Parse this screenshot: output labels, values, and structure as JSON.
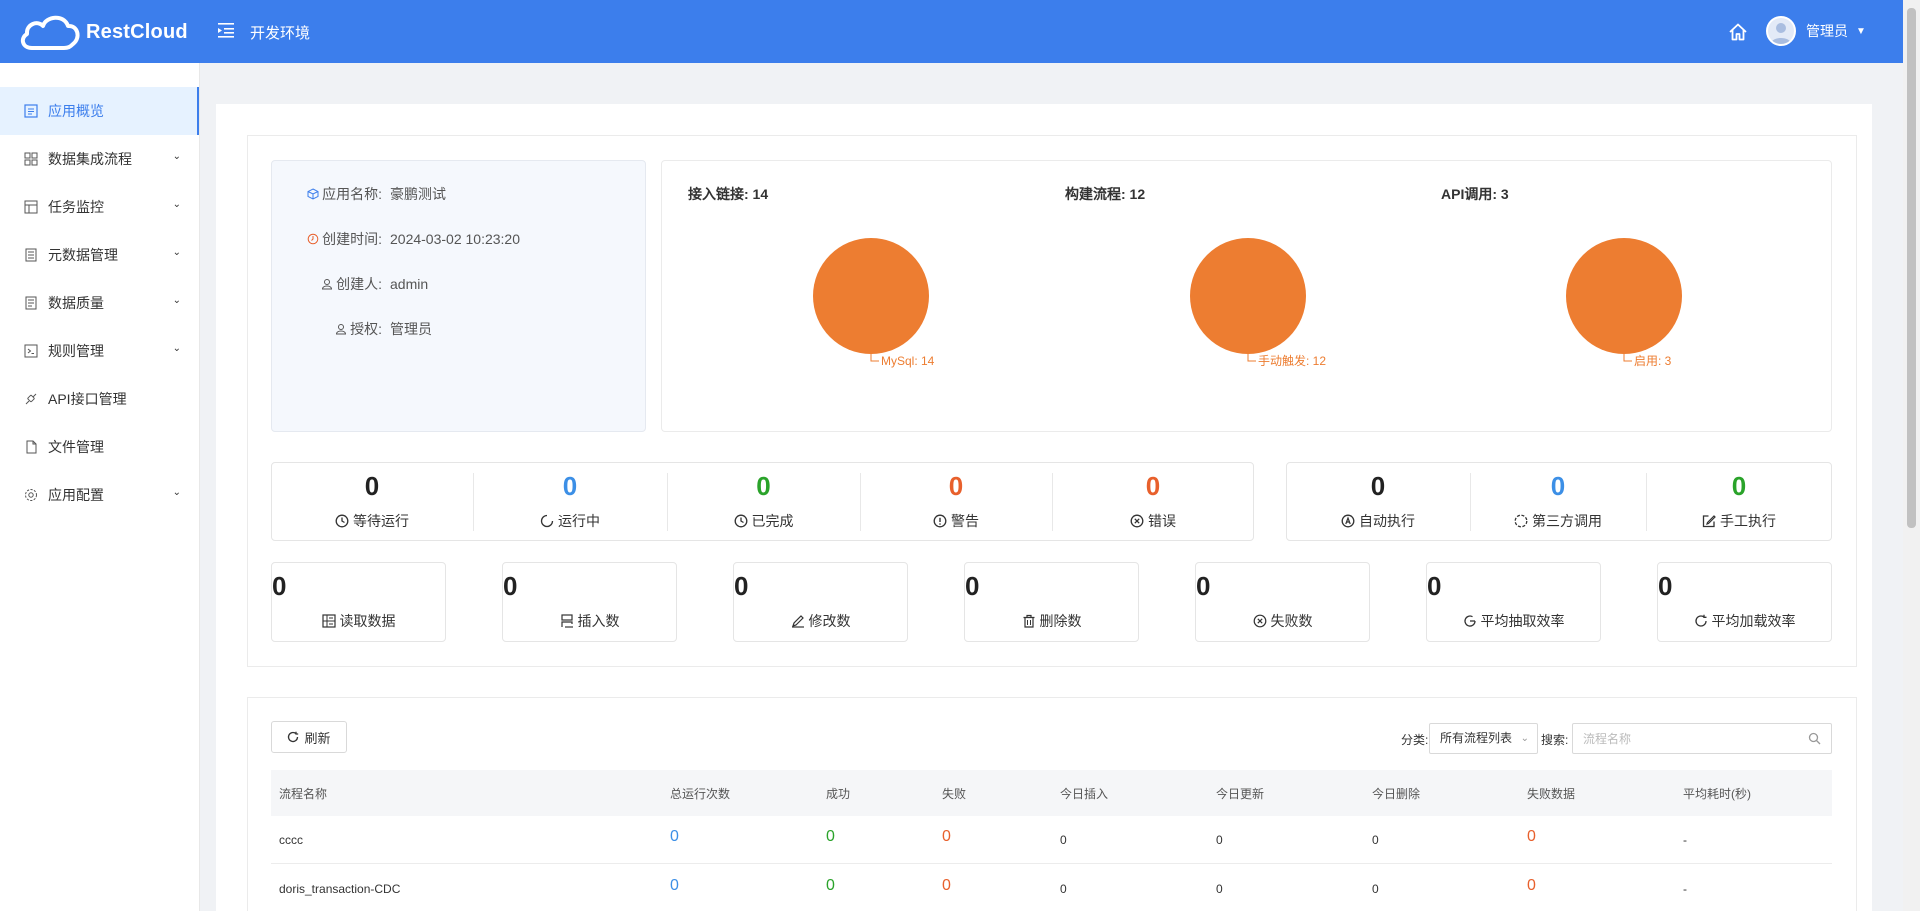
{
  "header": {
    "logo_text": "RestCloud",
    "env_label": "开发环境",
    "user_name": "管理员"
  },
  "sidebar": {
    "items": [
      {
        "label": "应用概览",
        "icon": "overview-icon",
        "active": true,
        "expandable": false
      },
      {
        "label": "数据集成流程",
        "icon": "grid-icon",
        "expandable": true
      },
      {
        "label": "任务监控",
        "icon": "monitor-icon",
        "expandable": true
      },
      {
        "label": "元数据管理",
        "icon": "metadata-icon",
        "expandable": true
      },
      {
        "label": "数据质量",
        "icon": "quality-icon",
        "expandable": true
      },
      {
        "label": "规则管理",
        "icon": "rule-icon",
        "expandable": true
      },
      {
        "label": "API接口管理",
        "icon": "api-icon",
        "expandable": false
      },
      {
        "label": "文件管理",
        "icon": "file-icon",
        "expandable": false
      },
      {
        "label": "应用配置",
        "icon": "settings-icon",
        "expandable": true
      }
    ]
  },
  "app_info": {
    "name_label": "应用名称:",
    "name_value": "豪鹏测试",
    "created_label": "创建时间:",
    "created_value": "2024-03-02 10:23:20",
    "creator_label": "创建人:",
    "creator_value": "admin",
    "auth_label": "授权:",
    "auth_value": "管理员"
  },
  "pies": [
    {
      "title": "接入链接: 14",
      "slice_label": "MySql: 14",
      "slices": [
        {
          "name": "MySql",
          "value": 14
        }
      ]
    },
    {
      "title": "构建流程: 12",
      "slice_label": "手动触发: 12",
      "slices": [
        {
          "name": "手动触发",
          "value": 12
        }
      ]
    },
    {
      "title": "API调用: 3",
      "slice_label": "启用: 3",
      "slices": [
        {
          "name": "启用",
          "value": 3
        }
      ]
    }
  ],
  "status_stats": [
    {
      "value": "0",
      "label": "等待运行",
      "color": "#222222",
      "icon": "clock-icon"
    },
    {
      "value": "0",
      "label": "运行中",
      "color": "#3c8fe6",
      "icon": "loading-icon"
    },
    {
      "value": "0",
      "label": "已完成",
      "color": "#2aa32a",
      "icon": "clock-check-icon"
    },
    {
      "value": "0",
      "label": "警告",
      "color": "#e8602c",
      "icon": "warning-icon"
    },
    {
      "value": "0",
      "label": "错误",
      "color": "#e8602c",
      "icon": "error-icon"
    }
  ],
  "exec_stats": [
    {
      "value": "0",
      "label": "自动执行",
      "color": "#222222",
      "icon": "auto-icon"
    },
    {
      "value": "0",
      "label": "第三方调用",
      "color": "#3c8fe6",
      "icon": "third-party-icon"
    },
    {
      "value": "0",
      "label": "手工执行",
      "color": "#2aa32a",
      "icon": "edit-icon"
    }
  ],
  "data_stats": [
    {
      "value": "0",
      "label": "读取数据",
      "icon": "read-icon"
    },
    {
      "value": "0",
      "label": "插入数",
      "icon": "insert-icon"
    },
    {
      "value": "0",
      "label": "修改数",
      "icon": "modify-icon"
    },
    {
      "value": "0",
      "label": "删除数",
      "icon": "trash-icon"
    },
    {
      "value": "0",
      "label": "失败数",
      "icon": "fail-icon"
    },
    {
      "value": "0",
      "label": "平均抽取效率",
      "icon": "extract-rate-icon"
    },
    {
      "value": "0",
      "label": "平均加载效率",
      "icon": "load-rate-icon"
    }
  ],
  "toolbar": {
    "refresh_label": "刷新",
    "category_label": "分类:",
    "category_value": "所有流程列表",
    "search_label": "搜索:",
    "search_placeholder": "流程名称"
  },
  "table": {
    "columns": [
      "流程名称",
      "总运行次数",
      "成功",
      "失败",
      "今日插入",
      "今日更新",
      "今日删除",
      "失败数据",
      "平均耗时(秒)"
    ],
    "rows": [
      [
        "cccc",
        "0",
        "0",
        "0",
        "0",
        "0",
        "0",
        "0",
        "-"
      ],
      [
        "doris_transaction-CDC",
        "0",
        "0",
        "0",
        "0",
        "0",
        "0",
        "0",
        "-"
      ]
    ]
  },
  "colors": {
    "header_bg": "#3c7eec",
    "pie_fill": "#ed7d31",
    "blue": "#3c8fe6",
    "green": "#2aa32a",
    "orange": "#e8602c"
  }
}
